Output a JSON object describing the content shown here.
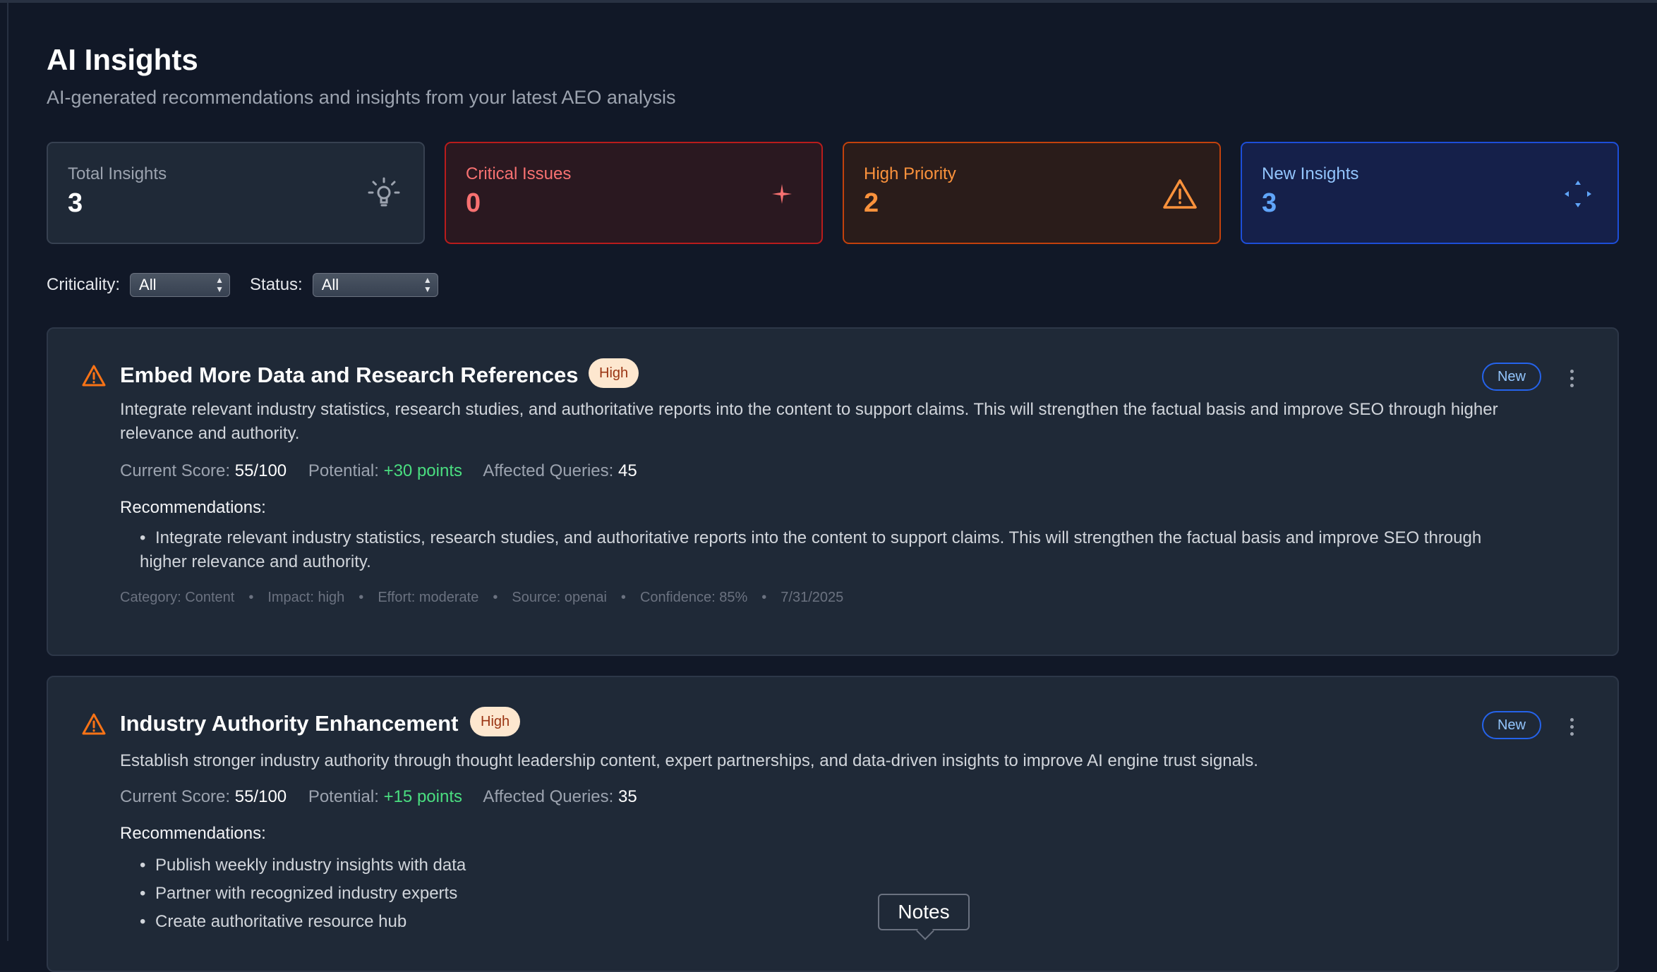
{
  "header": {
    "title": "AI Insights",
    "subtitle": "AI-generated recommendations and insights from your latest AEO analysis"
  },
  "stats": [
    {
      "label": "Total Insights",
      "value": "3",
      "icon": "lightbulb-icon"
    },
    {
      "label": "Critical Issues",
      "value": "0",
      "icon": "sparkle-icon"
    },
    {
      "label": "High Priority",
      "value": "2",
      "icon": "warning-triangle-icon"
    },
    {
      "label": "New Insights",
      "value": "3",
      "icon": "move-arrows-icon"
    }
  ],
  "filters": {
    "criticality_label": "Criticality:",
    "criticality_value": "All",
    "status_label": "Status:",
    "status_value": "All"
  },
  "metric_labels": {
    "current_score": "Current Score:",
    "potential": "Potential:",
    "affected_queries": "Affected Queries:",
    "recommendations": "Recommendations:"
  },
  "insights": [
    {
      "title": "Embed More Data and Research References",
      "priority": "High",
      "status": "New",
      "description": "Integrate relevant industry statistics, research studies, and authoritative reports into the content to support claims. This will strengthen the factual basis and improve SEO through higher relevance and authority.",
      "current_score": "55/100",
      "potential": "+30 points",
      "affected_queries": "45",
      "recommendations": [
        "Integrate relevant industry statistics, research studies, and authoritative reports into the content to support claims. This will strengthen the factual basis and improve SEO through higher relevance and authority."
      ],
      "meta": {
        "category": "Category: Content",
        "impact": "Impact: high",
        "effort": "Effort: moderate",
        "source": "Source: openai",
        "confidence": "Confidence: 85%",
        "date": "7/31/2025"
      }
    },
    {
      "title": "Industry Authority Enhancement",
      "priority": "High",
      "status": "New",
      "description": "Establish stronger industry authority through thought leadership content, expert partnerships, and data-driven insights to improve AI engine trust signals.",
      "current_score": "55/100",
      "potential": "+15 points",
      "affected_queries": "35",
      "recommendations": [
        "Publish weekly industry insights with data",
        "Partner with recognized industry experts",
        "Create authoritative resource hub"
      ]
    }
  ],
  "tooltip": "Notes",
  "colors": {
    "background": "#111827",
    "card": "#1f2937",
    "critical": "#f87171",
    "high": "#fb923c",
    "new": "#60a5fa",
    "positive": "#4ade80"
  }
}
